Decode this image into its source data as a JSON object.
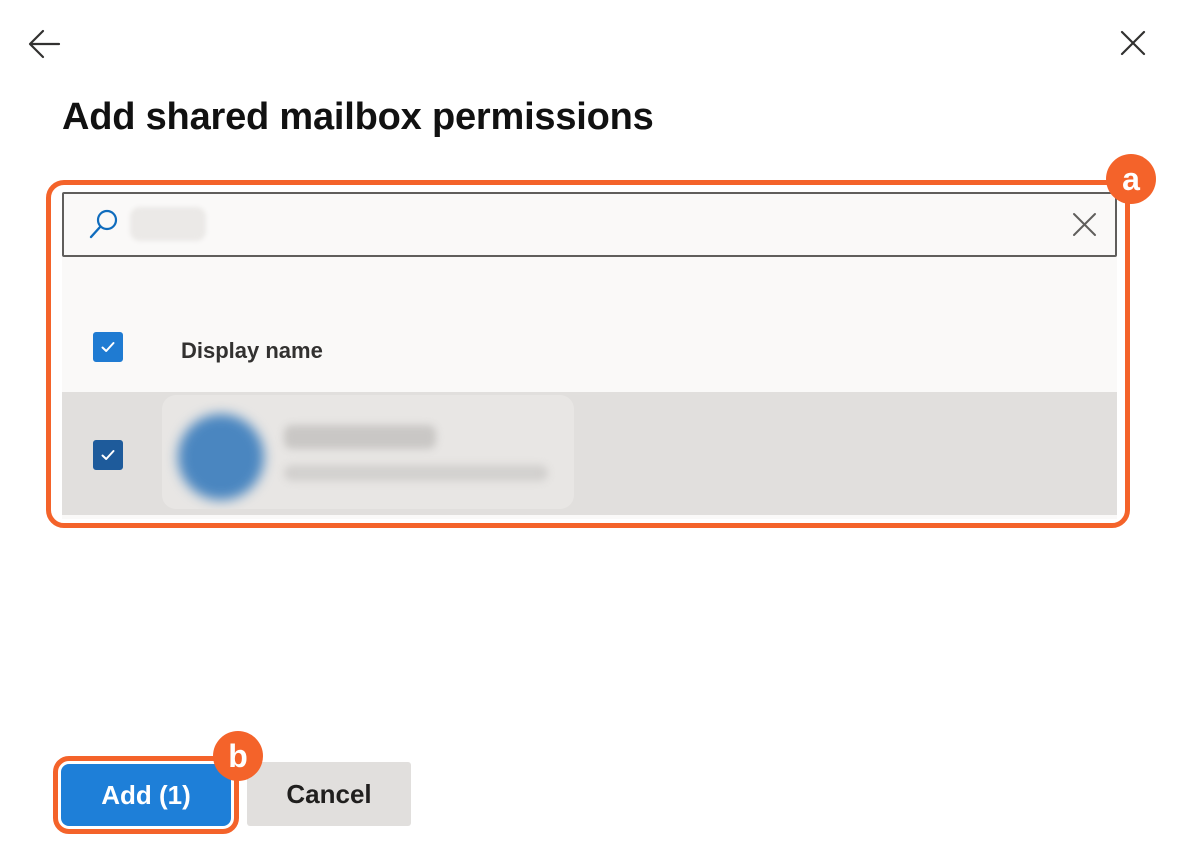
{
  "panel": {
    "title": "Add shared mailbox permissions"
  },
  "icons": {
    "back": "arrow-left-icon",
    "close": "close-icon",
    "search": "search-icon",
    "clear": "clear-search-icon",
    "check": "checkmark-icon"
  },
  "search": {
    "value": ""
  },
  "table": {
    "columns": [
      "Display name"
    ],
    "rows": [
      {
        "selected": true,
        "name": "",
        "email": ""
      }
    ]
  },
  "callouts": {
    "a": "a",
    "b": "b"
  },
  "footer": {
    "add_label": "Add (1)",
    "cancel_label": "Cancel"
  },
  "colors": {
    "accent": "#1e7fd8",
    "callout": "#f4632a",
    "row_selected": "#e1dfdd",
    "checkbox": "#1c6fc3"
  }
}
